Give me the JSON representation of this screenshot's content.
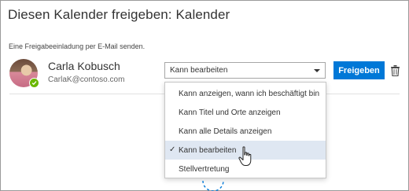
{
  "dialog": {
    "title": "Diesen Kalender freigeben: Kalender",
    "subtitle": "Eine Freigabeeinladung per E-Mail senden."
  },
  "user": {
    "name": "Carla Kobusch",
    "email": "CarlaK@contoso.com",
    "presence": "available",
    "presence_color": "#6bb700"
  },
  "permission": {
    "selected": "Kann bearbeiten",
    "options": [
      "Kann anzeigen, wann ich beschäftigt bin",
      "Kann Titel und Orte anzeigen",
      "Kann alle Details anzeigen",
      "Kann bearbeiten",
      "Stellvertretung"
    ],
    "selected_index": 3
  },
  "actions": {
    "share_label": "Freigeben",
    "delete_icon": "trash-icon"
  },
  "colors": {
    "accent": "#0078d7",
    "selected_row": "#dfe7f2"
  }
}
